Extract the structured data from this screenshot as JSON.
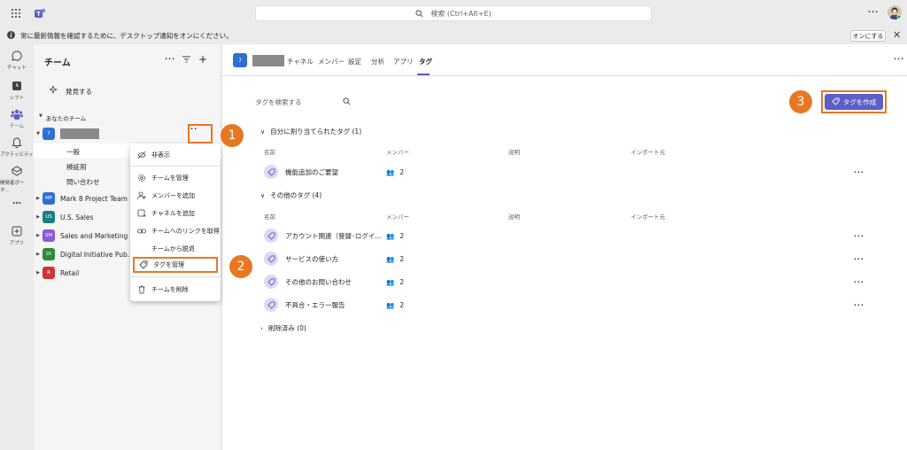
{
  "search": {
    "placeholder": "検索 (Ctrl+Alt+E)"
  },
  "notification": {
    "text": "常に最新情報を確認するために、デスクトップ通知をオンにください。",
    "button": "オンにする"
  },
  "rail": [
    {
      "label": "チャット",
      "icon": "chat-icon"
    },
    {
      "label": "シフト",
      "icon": "shifts-icon"
    },
    {
      "label": "チーム",
      "icon": "teams-icon"
    },
    {
      "label": "アクティビティ",
      "icon": "bell-icon"
    },
    {
      "label": "開発者ポータ…",
      "icon": "dev-portal-icon"
    },
    {
      "label": "…",
      "icon": "more-icon"
    },
    {
      "label": "アプリ",
      "icon": "apps-icon"
    }
  ],
  "panel": {
    "title": "チーム",
    "discover": "発見する",
    "section": "あなたのチーム",
    "channels": [
      "一般",
      "検証用",
      "問い合わせ"
    ],
    "teams": [
      {
        "abbr": "MP",
        "name": "Mark 8 Project Team",
        "color": "#2f6fd3"
      },
      {
        "abbr": "US",
        "name": "U.S. Sales",
        "color": "#1b7e7e"
      },
      {
        "abbr": "SM",
        "name": "Sales and Marketing",
        "color": "#8c5ad8"
      },
      {
        "abbr": "DI",
        "name": "Digital Initiative Pub…",
        "color": "#2e8b3a"
      },
      {
        "abbr": "R",
        "name": "Retail",
        "color": "#d13438"
      }
    ],
    "selected_abbr": "7"
  },
  "menu": {
    "items": [
      {
        "label": "非表示",
        "icon": "hide-icon"
      },
      {
        "label": "チームを管理",
        "icon": "gear-icon"
      },
      {
        "label": "メンバーを追加",
        "icon": "add-person-icon"
      },
      {
        "label": "チャネルを追加",
        "icon": "add-channel-icon"
      },
      {
        "label": "チームへのリンクを取得",
        "icon": "link-icon"
      },
      {
        "label": "チームから脱退",
        "icon": "leave-icon"
      },
      {
        "label": "タグを管理",
        "icon": "tag-icon"
      },
      {
        "label": "チームを削除",
        "icon": "trash-icon"
      }
    ]
  },
  "header": {
    "team_abbr": "7",
    "tabs": [
      "チャネル",
      "メンバー",
      "設定",
      "分析",
      "アプリ",
      "タグ"
    ],
    "active_tab": "タグ"
  },
  "tags": {
    "search_placeholder": "タグを検索する",
    "create_button": "タグを作成",
    "assigned_section": "自分に割り当てられたタグ (1)",
    "other_section": "その他のタグ (4)",
    "deleted_section": "削除済み (0)",
    "columns": [
      "名前",
      "メンバー",
      "説明",
      "インポート元"
    ],
    "assigned": [
      {
        "name": "機能追加のご要望",
        "members": "2"
      }
    ],
    "other": [
      {
        "name": "アカウント関連（登録･ログイ…",
        "members": "2"
      },
      {
        "name": "サービスの使い方",
        "members": "2"
      },
      {
        "name": "その他のお問い合わせ",
        "members": "2"
      },
      {
        "name": "不具合・エラー報告",
        "members": "2"
      }
    ]
  },
  "callouts": [
    "1",
    "2",
    "3"
  ],
  "colors": {
    "accent": "#5b5fc7",
    "callout": "#e87722"
  }
}
